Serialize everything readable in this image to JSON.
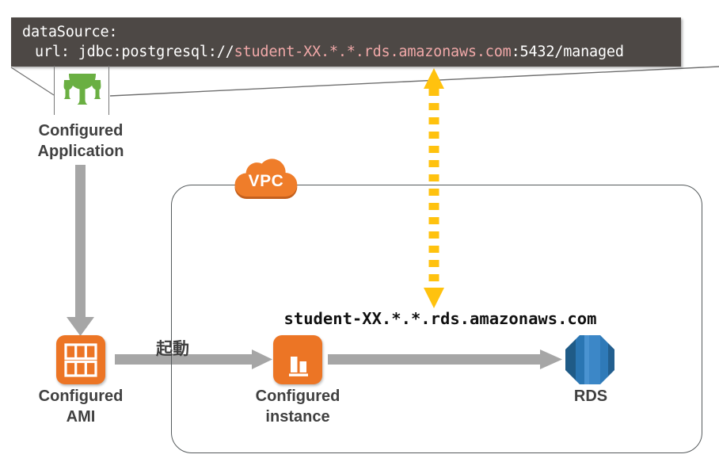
{
  "diagram": {
    "title": "AWS RDS managed database connection diagram",
    "code_callout": {
      "line1": "dataSource:",
      "line2_prefix": "url: jdbc:postgresql://",
      "line2_host": "student-XX.*.*.rds.amazonaws.com",
      "line2_suffix": ":5432/managed",
      "background_color": "#4d4845",
      "text_color": "#ffffff",
      "host_highlight_color": "#f0a8a8"
    },
    "nodes": {
      "application": {
        "label": "Configured\nApplication",
        "icon": "gradle-icon",
        "icon_color": "#6aaf42"
      },
      "ami": {
        "label": "Configured\nAMI",
        "icon": "ami-icon",
        "icon_color": "#ec7525"
      },
      "instance": {
        "label": "Configured\ninstance",
        "icon": "ec2-instance-icon",
        "icon_color": "#ec7525"
      },
      "rds": {
        "label": "RDS",
        "icon": "rds-icon",
        "icon_color": "#2e73a7"
      }
    },
    "vpc": {
      "badge_label": "VPC",
      "badge_color": "#ef7d2a",
      "border_color": "#555a5c"
    },
    "edges": {
      "launch_label": "起動",
      "endpoint_label": "student-XX.*.*.rds.amazonaws.com",
      "arrow_gray": "#a6a6a6",
      "arrow_yellow": "#ffc20e"
    }
  }
}
